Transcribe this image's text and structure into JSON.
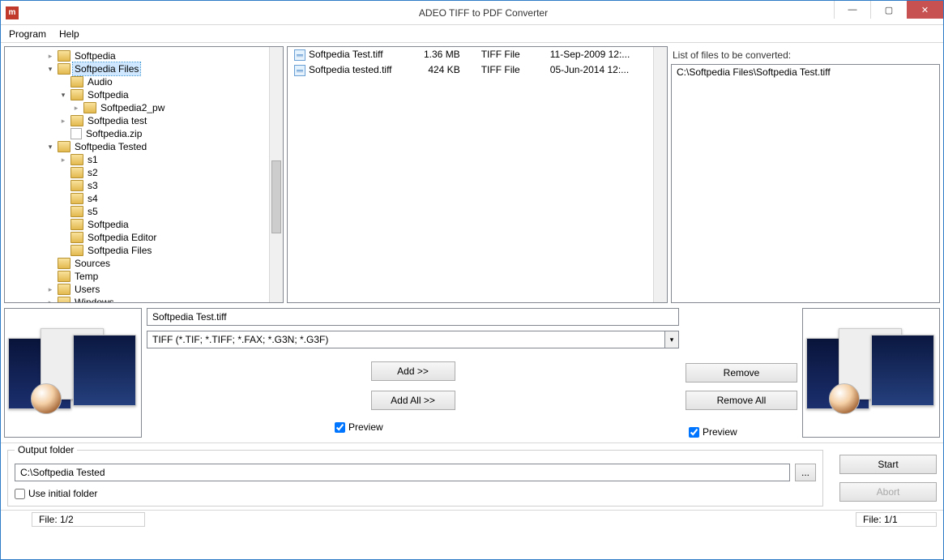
{
  "window": {
    "title": "ADEO TIFF to PDF Converter",
    "app_icon_glyph": "⌂"
  },
  "menu": {
    "program": "Program",
    "help": "Help"
  },
  "tree": [
    {
      "label": "Softpedia",
      "depth": 3,
      "expander": "off",
      "kind": "folder"
    },
    {
      "label": "Softpedia Files",
      "depth": 3,
      "expander": "on",
      "kind": "folder",
      "selected": true
    },
    {
      "label": "Audio",
      "depth": 4,
      "expander": "",
      "kind": "folder"
    },
    {
      "label": "Softpedia",
      "depth": 4,
      "expander": "on",
      "kind": "folder"
    },
    {
      "label": "Softpedia2_pw",
      "depth": 5,
      "expander": "off",
      "kind": "folder"
    },
    {
      "label": "Softpedia test",
      "depth": 4,
      "expander": "off",
      "kind": "folder"
    },
    {
      "label": "Softpedia.zip",
      "depth": 4,
      "expander": "",
      "kind": "file"
    },
    {
      "label": "Softpedia Tested",
      "depth": 3,
      "expander": "on",
      "kind": "folder"
    },
    {
      "label": "s1",
      "depth": 4,
      "expander": "off",
      "kind": "folder"
    },
    {
      "label": "s2",
      "depth": 4,
      "expander": "",
      "kind": "folder"
    },
    {
      "label": "s3",
      "depth": 4,
      "expander": "",
      "kind": "folder"
    },
    {
      "label": "s4",
      "depth": 4,
      "expander": "",
      "kind": "folder"
    },
    {
      "label": "s5",
      "depth": 4,
      "expander": "",
      "kind": "folder"
    },
    {
      "label": "Softpedia",
      "depth": 4,
      "expander": "",
      "kind": "folder"
    },
    {
      "label": "Softpedia Editor",
      "depth": 4,
      "expander": "",
      "kind": "folder"
    },
    {
      "label": "Softpedia Files",
      "depth": 4,
      "expander": "",
      "kind": "folder"
    },
    {
      "label": "Sources",
      "depth": 3,
      "expander": "",
      "kind": "folder"
    },
    {
      "label": "Temp",
      "depth": 3,
      "expander": "",
      "kind": "folder"
    },
    {
      "label": "Users",
      "depth": 3,
      "expander": "off",
      "kind": "folder"
    },
    {
      "label": "Windows",
      "depth": 3,
      "expander": "off",
      "kind": "folder"
    }
  ],
  "files": [
    {
      "name": "Softpedia Test.tiff",
      "size": "1.36 MB",
      "type": "TIFF File",
      "date": "11-Sep-2009 12:..."
    },
    {
      "name": "Softpedia tested.tiff",
      "size": "424 KB",
      "type": "TIFF File",
      "date": "05-Jun-2014 12:..."
    }
  ],
  "right_list": {
    "title": "List of files to be converted:",
    "items": [
      "C:\\Softpedia Files\\Softpedia Test.tiff"
    ]
  },
  "controls": {
    "filename_value": "Softpedia Test.tiff",
    "filter_value": "TIFF (*.TIF; *.TIFF; *.FAX; *.G3N; *.G3F)",
    "add": "Add >>",
    "add_all": "Add All >>",
    "preview": "Preview",
    "remove": "Remove",
    "remove_all": "Remove All"
  },
  "output": {
    "legend": "Output folder",
    "path": "C:\\Softpedia Tested",
    "browse": "...",
    "use_initial": "Use initial folder",
    "start": "Start",
    "abort": "Abort"
  },
  "status": {
    "left": "File: 1/2",
    "right": "File: 1/1"
  }
}
